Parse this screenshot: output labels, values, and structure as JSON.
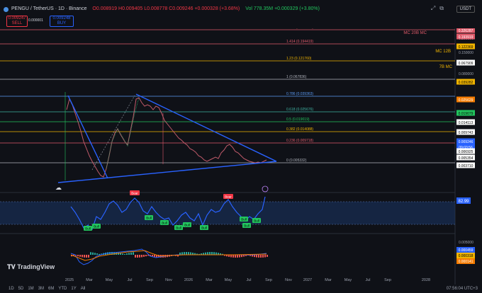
{
  "header": {
    "symbol": "PENGU / TetherUS · 1D · Binance",
    "ohlc": "O0.008919 H0.009405 L0.008778 C0.009246 +0.000328 (+3.68%)",
    "volume": "Vol 778.35M +0.000329 (+3.80%)",
    "sell_price": "0.009247",
    "sell_label": "SELL",
    "spread": "0.000001",
    "buy_price": "0.009248",
    "buy_label": "BUY",
    "currency": "USDT"
  },
  "fib_levels": [
    {
      "label": "1.618 (0.326825)",
      "color": "#e05a6a"
    },
    {
      "label": "1.414 (0.194419)",
      "color": "#e05a6a"
    },
    {
      "label": "1.23 (0.121760)",
      "color": "#f0b400"
    },
    {
      "label": "1 (0.067836)",
      "color": "#b2b5be"
    },
    {
      "label": "0.786 (0.039363)",
      "color": "#5b9cf6"
    },
    {
      "label": "0.618 (0.025676)",
      "color": "#3fb3a3"
    },
    {
      "label": "0.5 (0.019019)",
      "color": "#22c55e"
    },
    {
      "label": "0.382 (0.014088)",
      "color": "#f0b400"
    },
    {
      "label": "0.236 (0.009718)",
      "color": "#e05a6a"
    },
    {
      "label": "0 (0.005332)",
      "color": "#b2b5be"
    }
  ],
  "annotations": {
    "mc20b": "MC 20B  MC",
    "mc12b": "MC 12B",
    "mc7b": "7B MC"
  },
  "price_axis": {
    "tags": [
      {
        "text": "0.326287",
        "bg": "#e05a6a",
        "fg": "#fff"
      },
      {
        "text": "0.193919",
        "bg": "#e05a6a",
        "fg": "#fff"
      },
      {
        "text": "0.122369",
        "bg": "#f0b400",
        "fg": "#000"
      },
      {
        "text": "0.067909",
        "bg": "#ffffff",
        "fg": "#000"
      },
      {
        "text": "0.039282",
        "bg": "#f0b400",
        "fg": "#000"
      },
      {
        "text": "0.025629",
        "bg": "#f57c00",
        "fg": "#fff"
      },
      {
        "text": "0.019079",
        "bg": "#22c55e",
        "fg": "#000"
      },
      {
        "text": "0.014113",
        "bg": "#ffffff",
        "fg": "#000"
      },
      {
        "text": "0.009743",
        "bg": "#ffffff",
        "fg": "#000"
      },
      {
        "text": "0.009246",
        "bg": "#2962ff",
        "fg": "#fff"
      },
      {
        "text": "09:03:56",
        "bg": "#2962ff",
        "fg": "#fff"
      },
      {
        "text": "0.006925",
        "bg": "#ffffff",
        "fg": "#000"
      },
      {
        "text": "0.005354",
        "bg": "#ffffff",
        "fg": "#000"
      },
      {
        "text": "0.003710",
        "bg": "#ffffff",
        "fg": "#000"
      }
    ],
    "plain": [
      "0.350000",
      "0.200000",
      "0.150000",
      "0.080000"
    ]
  },
  "rsi": {
    "value": "82.99",
    "bear_label": "Bear",
    "bull_label": "Bull"
  },
  "macd": {
    "axis_tags": [
      {
        "text": "0.000459",
        "bg": "#2962ff",
        "fg": "#fff"
      },
      {
        "text": "0.000318",
        "bg": "#f0b400",
        "fg": "#000"
      },
      {
        "text": "0.000141",
        "bg": "#f57c00",
        "fg": "#fff"
      }
    ],
    "plain": [
      "0.005000",
      "0.000000"
    ]
  },
  "time_axis": [
    "2025",
    "Mar",
    "May",
    "Jul",
    "Sep",
    "Nov",
    "2026",
    "Mar",
    "May",
    "Jul",
    "Sep",
    "Nov",
    "2027",
    "Mar",
    "May",
    "Jul",
    "Sep",
    "2028"
  ],
  "footer": {
    "ranges": [
      "1D",
      "5D",
      "1M",
      "3M",
      "6M",
      "YTD",
      "1Y",
      "All"
    ],
    "clock": "07:56:04 UTC+3",
    "brand": "TradingView"
  }
}
